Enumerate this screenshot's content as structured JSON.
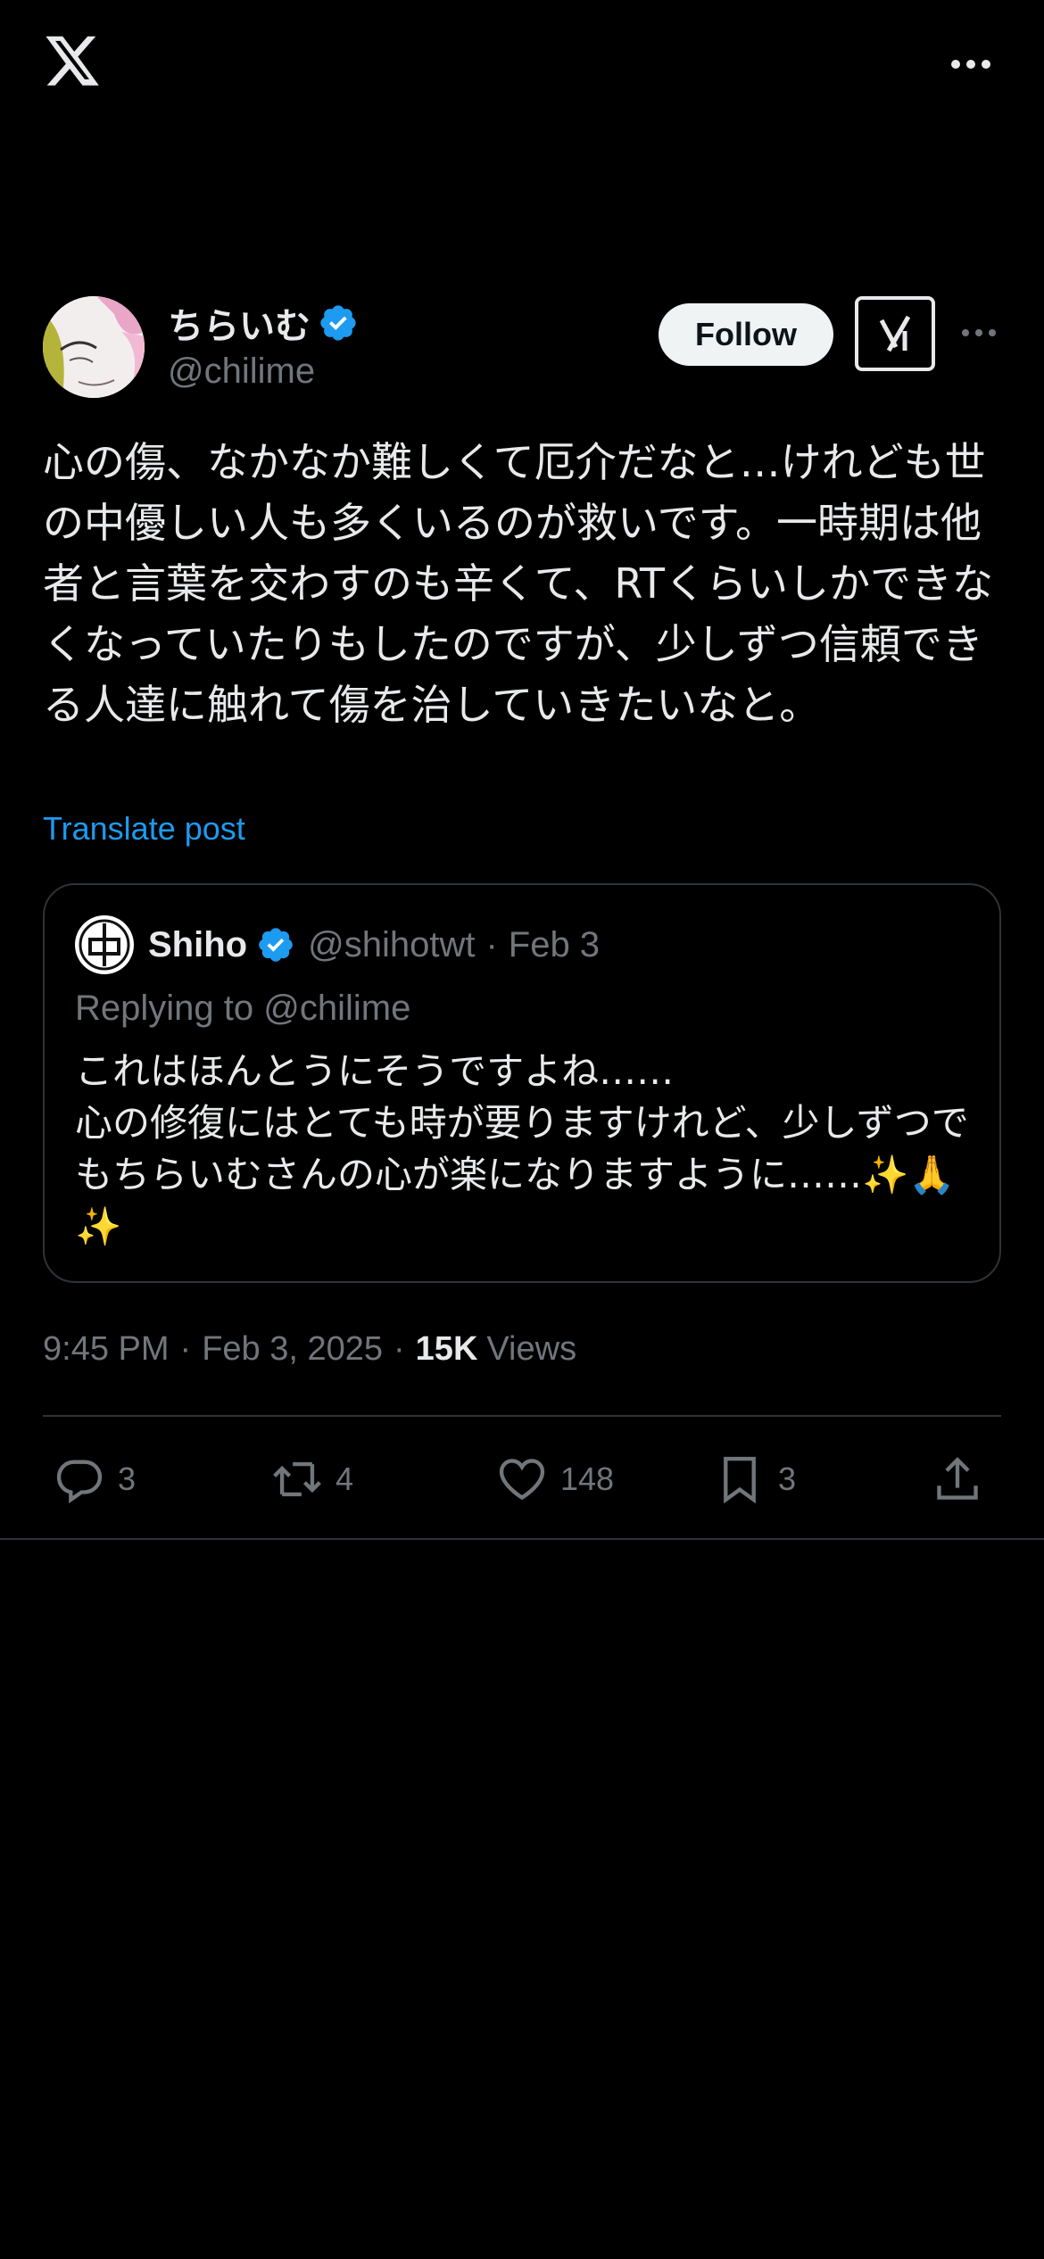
{
  "colors": {
    "background": "#000000",
    "text": "#e7e9ea",
    "secondary": "#71767b",
    "link": "#1d9bf0",
    "border": "#2f3336",
    "verified": "#1d9bf0",
    "follow_bg": "#eff3f4"
  },
  "topbar": {
    "logo_icon": "x-logo-icon",
    "more_icon": "more-horizontal-icon"
  },
  "author": {
    "display_name": "ちらいむ",
    "handle": "@chilime",
    "verified": true,
    "follow_label": "Follow",
    "grok_icon": "grok-icon",
    "more_icon": "more-horizontal-icon"
  },
  "tweet": {
    "text": "心の傷、なかなか難しくて厄介だなと…けれども世の中優しい人も多くいるのが救いです。一時期は他者と言葉を交わすのも辛くて、RTくらいしかできなくなっていたりもしたのですが、少しずつ信頼できる人達に触れて傷を治していきたいなと。",
    "translate_label": "Translate post"
  },
  "quote": {
    "name": "Shiho",
    "handle": "@shihotwt",
    "separator": "·",
    "date": "Feb 3",
    "replying_to": "Replying to @chilime",
    "text": "これはほんとうにそうですよね……\n心の修復にはとても時が要りますけれど、少しずつでもちらいむさんの心が楽になりますように……✨🙏✨"
  },
  "meta": {
    "time": "9:45 PM",
    "sep1": "·",
    "date": "Feb 3, 2025",
    "sep2": "·",
    "views_count": "15K",
    "views_label": "Views"
  },
  "actions": {
    "reply": {
      "icon": "reply-icon",
      "count": "3"
    },
    "repost": {
      "icon": "repost-icon",
      "count": "4"
    },
    "like": {
      "icon": "heart-icon",
      "count": "148"
    },
    "bookmark": {
      "icon": "bookmark-icon",
      "count": "3"
    },
    "share": {
      "icon": "share-icon"
    }
  }
}
